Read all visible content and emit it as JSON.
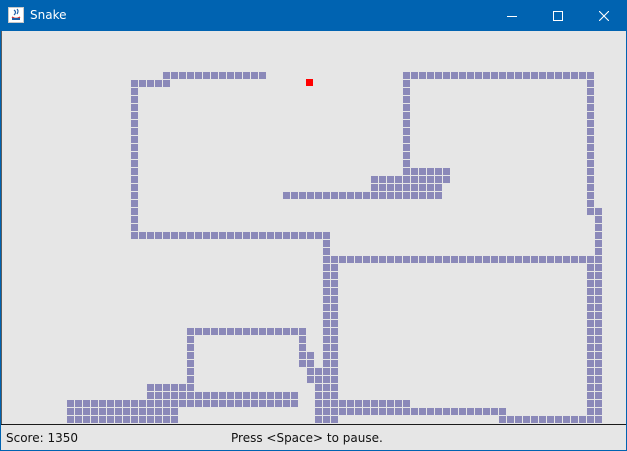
{
  "window": {
    "title": "Snake",
    "buttons": {
      "minimize": "minimize-icon",
      "maximize": "maximize-icon",
      "close": "close-icon"
    }
  },
  "colors": {
    "titlebar": "#0063b1",
    "board": "#e6e6e6",
    "snake": "#8b89b9",
    "food": "#ff0000"
  },
  "status": {
    "score": "Score: 1350",
    "hint": "Press <Space> to pause."
  }
}
